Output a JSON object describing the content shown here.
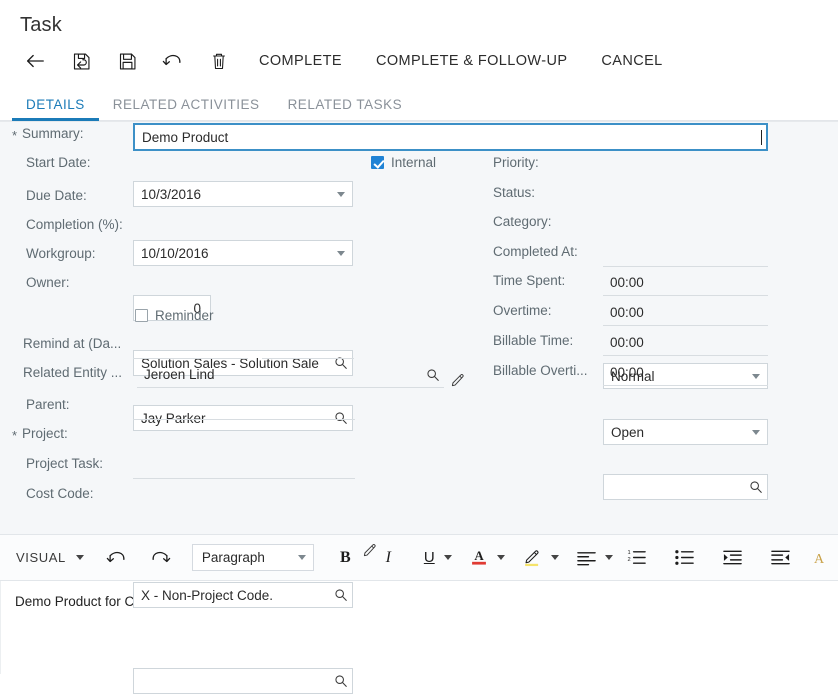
{
  "page_title": "Task",
  "toolbar": {
    "icons": [
      {
        "name": "back-arrow-icon",
        "label": "Back"
      },
      {
        "name": "save-and-back-icon",
        "label": "Save & Close"
      },
      {
        "name": "save-icon",
        "label": "Save"
      },
      {
        "name": "undo-icon",
        "label": "Cancel changes"
      },
      {
        "name": "delete-trash-icon",
        "label": "Delete"
      }
    ],
    "actions": [
      {
        "name": "complete-button",
        "label": "COMPLETE"
      },
      {
        "name": "complete-follow-up-button",
        "label": "COMPLETE & FOLLOW-UP"
      },
      {
        "name": "cancel-button",
        "label": "CANCEL"
      }
    ]
  },
  "tabs": [
    {
      "label": "DETAILS",
      "active": true
    },
    {
      "label": "RELATED ACTIVITIES",
      "active": false
    },
    {
      "label": "RELATED TASKS",
      "active": false
    }
  ],
  "accent_color": "#1b7bb8",
  "form": {
    "left": {
      "summary": {
        "label": "Summary:",
        "value": "Demo Product",
        "required": true,
        "focused": true
      },
      "start_date": {
        "label": "Start Date:",
        "value": "10/3/2016"
      },
      "due_date": {
        "label": "Due Date:",
        "value": "10/10/2016"
      },
      "completion": {
        "label": "Completion (%):",
        "value": "0"
      },
      "workgroup": {
        "label": "Workgroup:",
        "value": "Solution Sales - Solution Sale"
      },
      "owner": {
        "label": "Owner:",
        "value": "Jay Parker"
      },
      "internal": {
        "label": "Internal",
        "checked": true
      },
      "reminder": {
        "label": "Reminder",
        "checked": false
      },
      "remind_at": {
        "label": "Remind at (Da...",
        "value": "",
        "time_value": ""
      },
      "related_entity": {
        "label": "Related Entity ...",
        "value": "Jeroen Lind"
      },
      "parent": {
        "label": "Parent:",
        "value": ""
      },
      "project": {
        "label": "Project:",
        "value": "X - Non-Project Code.",
        "required": true
      },
      "project_task": {
        "label": "Project Task:",
        "value": ""
      },
      "cost_code": {
        "label": "Cost Code:",
        "value": ""
      }
    },
    "right": {
      "priority": {
        "label": "Priority:",
        "value": "Normal"
      },
      "status": {
        "label": "Status:",
        "value": "Open"
      },
      "category": {
        "label": "Category:",
        "value": ""
      },
      "completed_at": {
        "label": "Completed At:",
        "value": ""
      },
      "time_spent": {
        "label": "Time Spent:",
        "value": "00:00"
      },
      "overtime": {
        "label": "Overtime:",
        "value": "00:00"
      },
      "billable_time": {
        "label": "Billable Time:",
        "value": "00:00"
      },
      "billable_overtime": {
        "label": "Billable Overti...",
        "value": "00:00"
      }
    }
  },
  "editor": {
    "mode": "VISUAL",
    "undo_icon": "undo-icon",
    "redo_icon": "redo-icon",
    "paragraph_style": "Paragraph",
    "bold": "B",
    "italic": "I",
    "underline": "U",
    "font_color_icon": "font-color-icon",
    "highlight_icon": "highlighter-icon",
    "align_icon": "align-left-icon",
    "numbered_list_icon": "numbered-list-icon",
    "bulleted_list_icon": "bulleted-list-icon",
    "indent_icon": "indent-icon",
    "outdent_icon": "outdent-icon",
    "body_text": "Demo Product for Customer"
  }
}
